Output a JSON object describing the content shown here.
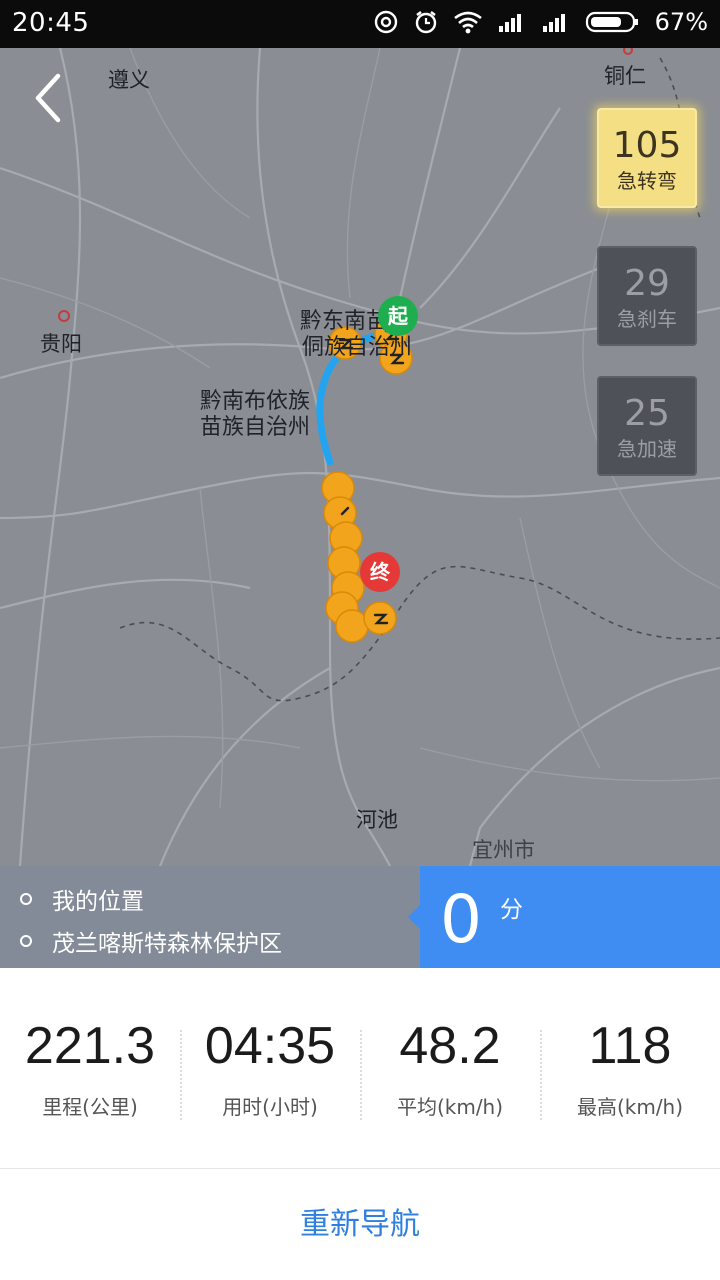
{
  "status_bar": {
    "time": "20:45",
    "battery": "67%"
  },
  "map": {
    "cities": {
      "zunyi": "遵义",
      "tongren": "铜仁",
      "guiyang": "贵阳",
      "qiandongnan_1": "黔东南苗",
      "qiandongnan_2": "侗族自治州",
      "qiannan_1": "黔南布依族",
      "qiannan_2": "苗族自治州",
      "hechi": "河池",
      "yizhou": "宜州市"
    },
    "start_label": "起",
    "end_label": "终",
    "stat_cards": [
      {
        "count": "105",
        "label": "急转弯"
      },
      {
        "count": "29",
        "label": "急刹车"
      },
      {
        "count": "25",
        "label": "急加速"
      }
    ]
  },
  "location": {
    "from": "我的位置",
    "to": "茂兰喀斯特森林保护区",
    "eta_value": "0",
    "eta_unit": "分"
  },
  "trip_stats": [
    {
      "value": "221.3",
      "label": "里程(公里)"
    },
    {
      "value": "04:35",
      "label": "用时(小时)"
    },
    {
      "value": "48.2",
      "label": "平均(km/h)"
    },
    {
      "value": "118",
      "label": "最高(km/h)"
    }
  ],
  "actions": {
    "renavigate": "重新导航"
  },
  "colors": {
    "route": "#23a4f0",
    "event_marker": "#f2a51c",
    "active_card": "#f5df84",
    "eta_panel": "#3f8cf3",
    "button_text": "#2f7fe0"
  }
}
